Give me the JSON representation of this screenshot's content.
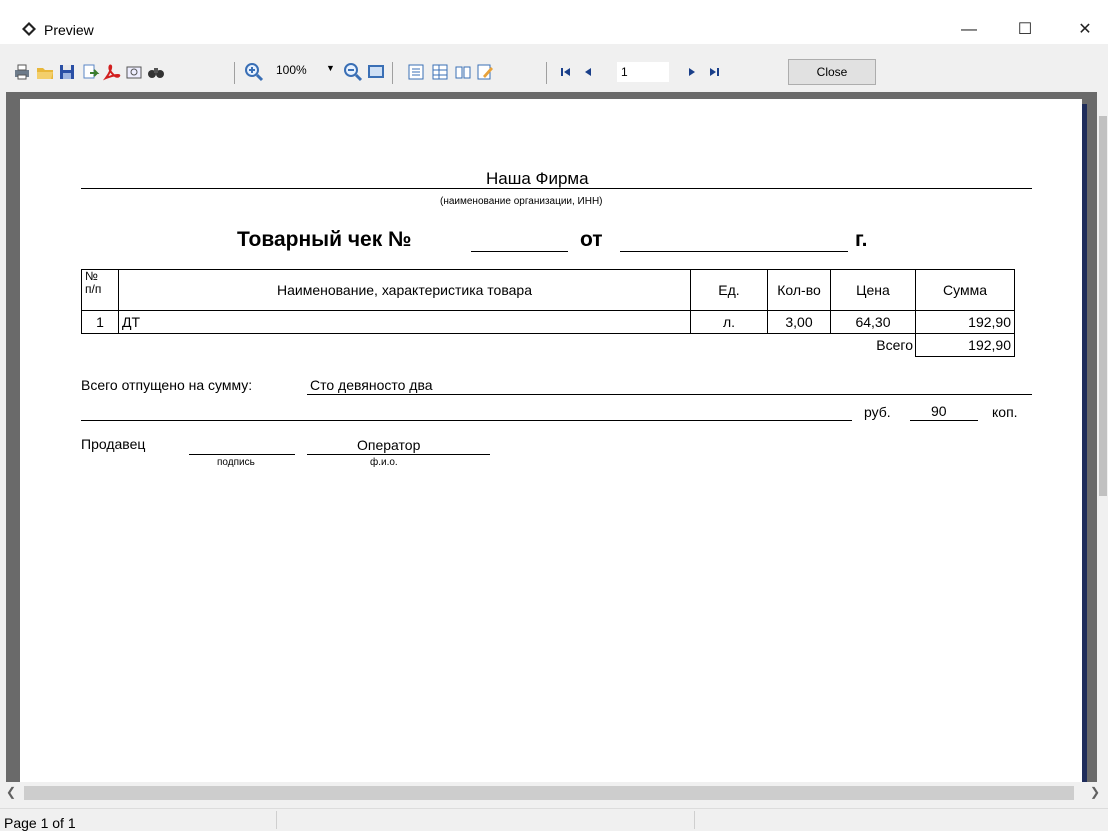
{
  "window": {
    "title": "Preview",
    "minimize_glyph": "—",
    "maximize_glyph": "☐",
    "close_glyph": "✕"
  },
  "toolbar": {
    "zoom_value": "100%",
    "page_value": "1",
    "close_label": "Close"
  },
  "statusbar": {
    "page_info": "Page 1 of 1"
  },
  "document": {
    "org_name": "Наша Фирма",
    "org_caption": "(наименование организации, ИНН)",
    "receipt_title": "Товарный чек №",
    "from_word": "от",
    "year_suffix": "г.",
    "table": {
      "headers": {
        "num": "№\nп/п",
        "name": "Наименование, характеристика товара",
        "unit": "Ед.",
        "qty": "Кол-во",
        "price": "Цена",
        "sum": "Сумма"
      },
      "rows": [
        {
          "num": "1",
          "name": "ДТ",
          "unit": "л.",
          "qty": "3,00",
          "price": "64,30",
          "sum": "192,90"
        }
      ],
      "total_label": "Всего",
      "total_value": "192,90"
    },
    "released_label": "Всего отпущено на сумму:",
    "released_words": "Сто девяносто два",
    "rub_label": "руб.",
    "kop_value": "90",
    "kop_label": "коп.",
    "seller_label": "Продавец",
    "signature_caption": "подпись",
    "operator_name": "Оператор",
    "fio_caption": "ф.и.о."
  }
}
